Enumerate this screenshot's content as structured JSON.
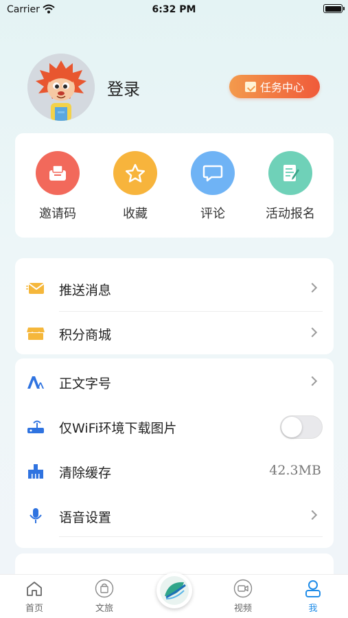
{
  "status_bar": {
    "carrier": "Carrier",
    "time": "6:32 PM"
  },
  "profile": {
    "login_label": "登录",
    "task_button_label": "任务中心"
  },
  "quick_actions": [
    {
      "label": "邀请码",
      "icon": "invite-code-icon",
      "color": "#f2695b"
    },
    {
      "label": "收藏",
      "icon": "star-icon",
      "color": "#f7b43c"
    },
    {
      "label": "评论",
      "icon": "comment-icon",
      "color": "#6fb3f5"
    },
    {
      "label": "活动报名",
      "icon": "signup-form-icon",
      "color": "#6fd1b8"
    }
  ],
  "menu": {
    "push_messages": "推送消息",
    "points_mall": "积分商城",
    "font_size": "正文字号",
    "wifi_only_images": "仅WiFi环境下载图片",
    "clear_cache": "清除缓存",
    "cache_size": "42.3MB",
    "voice_settings": "语音设置",
    "wifi_only_enabled": false
  },
  "tabbar": {
    "home": "首页",
    "culture_travel": "文旅",
    "video": "视频",
    "me": "我",
    "active_tab": "me"
  },
  "colors": {
    "accent": "#1f8ce8",
    "task_gradient_start": "#f39a4c",
    "task_gradient_end": "#f05a3a"
  }
}
